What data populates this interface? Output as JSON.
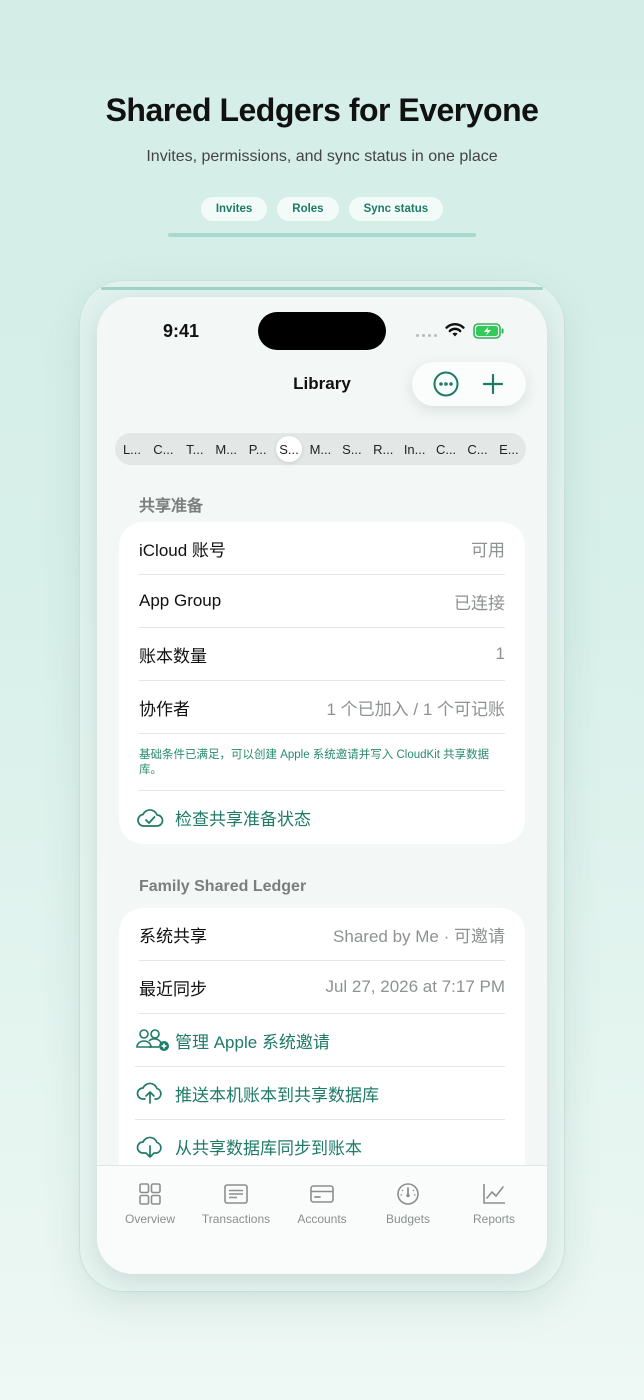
{
  "hero": {
    "title": "Shared Ledgers for Everyone",
    "subtitle": "Invites, permissions, and sync status in one place",
    "chips": [
      "Invites",
      "Roles",
      "Sync status"
    ]
  },
  "status_bar": {
    "time": "9:41"
  },
  "nav": {
    "title": "Library",
    "more_icon": "ellipsis-circle-icon",
    "add_icon": "plus-icon"
  },
  "segments": {
    "items": [
      "L...",
      "C...",
      "T...",
      "M...",
      "P...",
      "S...",
      "M...",
      "S...",
      "R...",
      "In...",
      "C...",
      "C...",
      "E..."
    ],
    "active_index": 5
  },
  "readiness": {
    "header": "共享准备",
    "rows": [
      {
        "label": "iCloud 账号",
        "value": "可用"
      },
      {
        "label": "App Group",
        "value": "已连接"
      },
      {
        "label": "账本数量",
        "value": "1"
      },
      {
        "label": "协作者",
        "value": "1 个已加入 / 1 个可记账"
      }
    ],
    "note": "基础条件已满足，可以创建 Apple 系统邀请并写入 CloudKit 共享数据库。",
    "check_action": "检查共享准备状态"
  },
  "ledger": {
    "header": "Family Shared Ledger",
    "rows": [
      {
        "label": "系统共享",
        "value": "Shared by Me · 可邀请"
      },
      {
        "label": "最近同步",
        "value": "Jul 27, 2026 at 7:17 PM"
      }
    ],
    "actions": [
      "管理 Apple 系统邀请",
      "推送本机账本到共享数据库",
      "从共享数据库同步到账本"
    ]
  },
  "tabbar": {
    "items": [
      {
        "label": "Overview",
        "icon": "grid-icon"
      },
      {
        "label": "Transactions",
        "icon": "list-icon"
      },
      {
        "label": "Accounts",
        "icon": "card-icon"
      },
      {
        "label": "Budgets",
        "icon": "gauge-icon"
      },
      {
        "label": "Reports",
        "icon": "chart-icon"
      }
    ]
  },
  "colors": {
    "accent": "#1f7a68",
    "note": "#2a8a6e",
    "background": "#d4ede7"
  }
}
